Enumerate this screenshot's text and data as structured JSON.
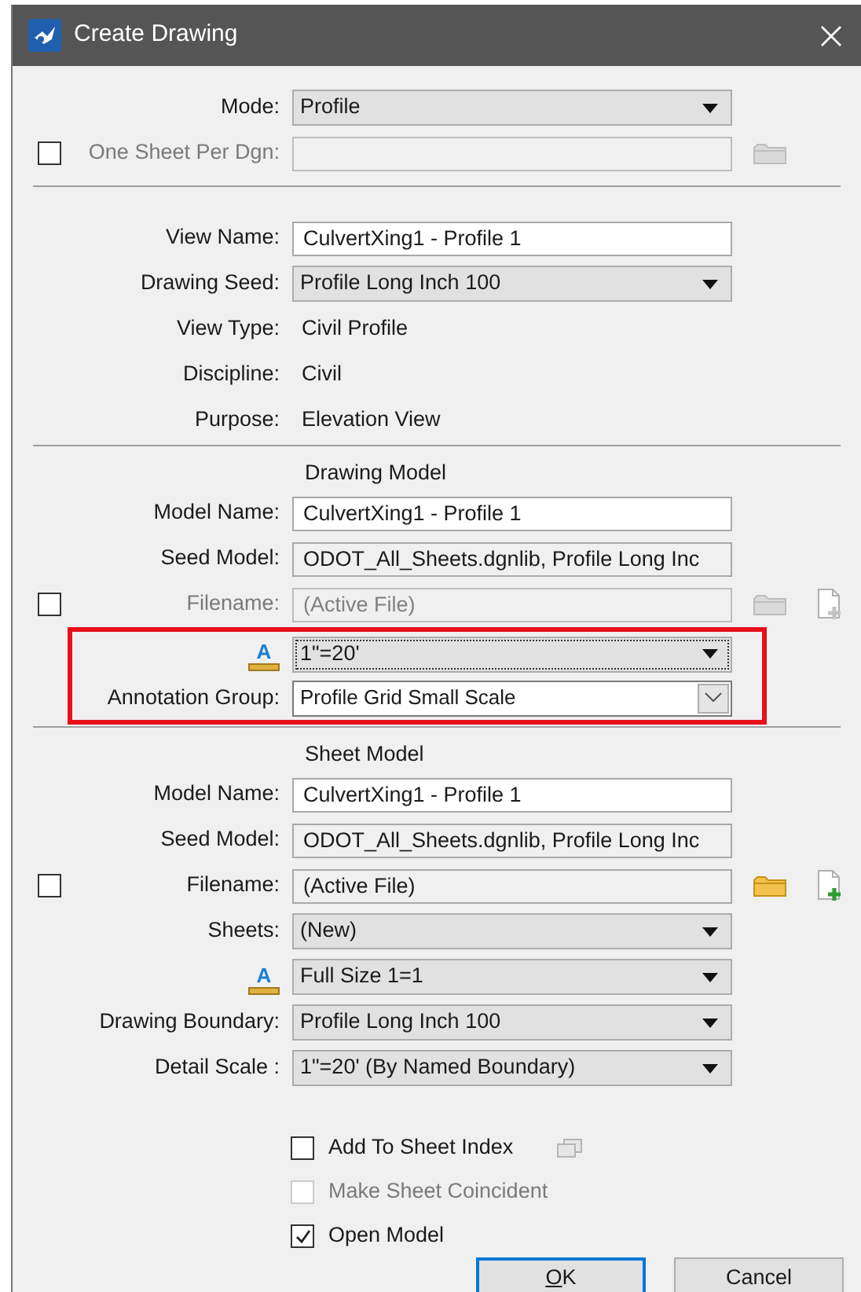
{
  "window": {
    "title": "Create Drawing"
  },
  "sections": [
    {
      "rows": [
        {
          "kind": "dropdown",
          "label": "Mode:",
          "value": "Profile"
        },
        {
          "kind": "input",
          "label": "One Sheet Per Dgn:",
          "disabled": true,
          "checkbox": {
            "checked": false
          },
          "browse": true
        }
      ]
    },
    {
      "rows": [
        {
          "kind": "input",
          "label": "View Name:",
          "value": "CulvertXing1 - Profile 1"
        },
        {
          "kind": "dropdown",
          "label": "Drawing Seed:",
          "value": "Profile Long Inch 100"
        },
        {
          "kind": "static",
          "label": "View Type:",
          "value": "Civil Profile"
        },
        {
          "kind": "static",
          "label": "Discipline:",
          "value": "Civil"
        },
        {
          "kind": "static",
          "label": "Purpose:",
          "value": "Elevation View"
        }
      ]
    },
    {
      "heading": "Drawing Model",
      "rows": [
        {
          "kind": "input",
          "label": "Model Name:",
          "value": "CulvertXing1 - Profile 1"
        },
        {
          "kind": "readonly",
          "label": "Seed Model:",
          "value": "ODOT_All_Sheets.dgnlib, Profile Long Inc"
        },
        {
          "kind": "readonly",
          "label": "Filename:",
          "value": "(Active File)",
          "disabled": true,
          "checkbox": {
            "checked": false
          },
          "browse": true,
          "new_file": true
        },
        {
          "kind": "dropdown",
          "label_icon": "A",
          "value": "1\"=20'",
          "focused": true,
          "highlighted": true
        },
        {
          "kind": "combo",
          "label": "Annotation Group:",
          "value": "Profile Grid Small Scale",
          "highlighted": true
        }
      ]
    },
    {
      "heading": "Sheet Model",
      "rows": [
        {
          "kind": "input",
          "label": "Model Name:",
          "value": "CulvertXing1 - Profile 1"
        },
        {
          "kind": "readonly",
          "label": "Seed Model:",
          "value": "ODOT_All_Sheets.dgnlib, Profile Long Inc"
        },
        {
          "kind": "readonly",
          "label": "Filename:",
          "value": "(Active File)",
          "checkbox": {
            "checked": false
          },
          "browse": true,
          "new_file": true
        },
        {
          "kind": "dropdown",
          "label": "Sheets:",
          "value": "(New)"
        },
        {
          "kind": "dropdown",
          "label_icon": "A",
          "value": "Full Size 1=1"
        },
        {
          "kind": "dropdown",
          "label": "Drawing Boundary:",
          "value": "Profile Long Inch 100"
        },
        {
          "kind": "dropdown",
          "label": "Detail Scale :",
          "value": "1\"=20' (By Named Boundary)"
        }
      ]
    }
  ],
  "options": [
    {
      "label": "Add To Sheet Index",
      "checked": false,
      "disabled": false,
      "index_button": true
    },
    {
      "label": "Make Sheet Coincident",
      "checked": false,
      "disabled": true
    },
    {
      "label": "Open Model",
      "checked": true,
      "disabled": false
    }
  ],
  "buttons": [
    {
      "label": "OK",
      "default": true,
      "underline_first": true
    },
    {
      "label": "Cancel",
      "default": false
    }
  ]
}
